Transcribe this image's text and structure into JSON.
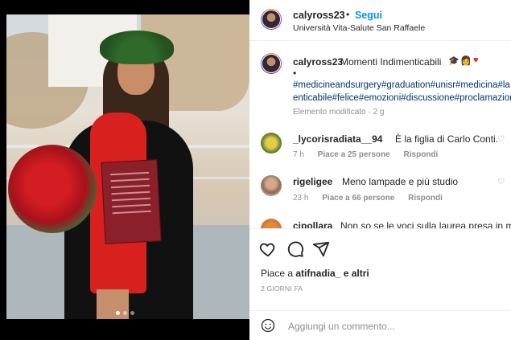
{
  "post": {
    "username": "calyross23",
    "dot": "•",
    "follow_label": "Segui",
    "location": "Università Vita-Salute San Raffaele"
  },
  "caption": {
    "username": "calyross23",
    "text": "Momenti Indimenticabili",
    "emojis": [
      "graduation-cap",
      "person",
      "red-heart"
    ],
    "dot": "•",
    "hashtags_line1": "#medicineandsurgery#graduation#unisr#medicina#la",
    "hashtags_line2": "enticabile#felice#emozioni#discussione#proclamazion",
    "edited": "Elemento modificato · 2 g"
  },
  "comments": [
    {
      "username": "_lycorisradiata__94",
      "text": "È la figlia di Carlo Conti.",
      "time": "7 h",
      "likes": "Piace a 25 persone",
      "reply": "Rispondi"
    },
    {
      "username": "rigeligee",
      "text": "Meno lampade e più studio",
      "time": "23 h",
      "likes": "Piace a 66 persone",
      "reply": "Rispondi"
    },
    {
      "username": "cipollara",
      "text": "Non so se le voci sulla laurea presa in modo"
    }
  ],
  "likes": {
    "prefix": "Piace a",
    "user": "atifnadia_",
    "suffix": "e altri"
  },
  "time_ago": "2 GIORNI FA",
  "comment_box": {
    "placeholder": "Aggiungi un commento..."
  },
  "colors": {
    "accent": "#0095f6",
    "heart": "#ed4956",
    "muted": "#8e8e8e"
  }
}
